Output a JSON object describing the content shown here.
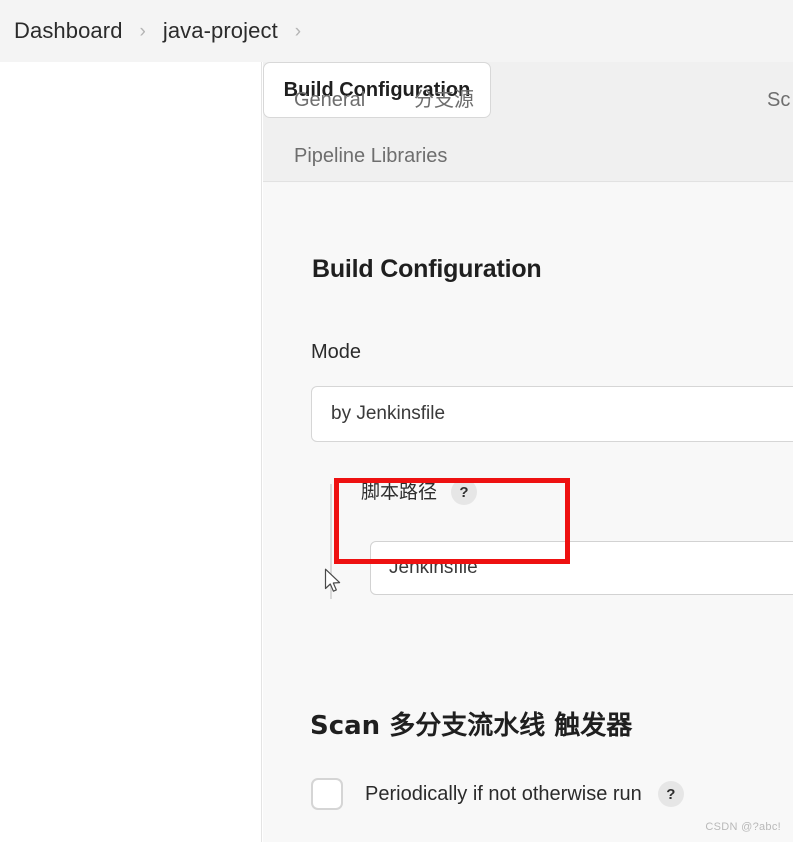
{
  "breadcrumb": {
    "items": [
      {
        "label": "Dashboard"
      },
      {
        "label": "java-project"
      }
    ],
    "separator": "›"
  },
  "tabs": [
    {
      "id": "general",
      "label": "General",
      "active": false
    },
    {
      "id": "branch-sources",
      "label": "分支源",
      "active": false
    },
    {
      "id": "build-configuration",
      "label": "Build Configuration",
      "active": true
    },
    {
      "id": "scan",
      "label": "Sc",
      "active": false,
      "truncated": true
    },
    {
      "id": "pipeline-libraries",
      "label": "Pipeline Libraries",
      "active": false
    }
  ],
  "main": {
    "section_title": "Build Configuration",
    "mode": {
      "label": "Mode",
      "selected_value": "by Jenkinsfile"
    },
    "script_path": {
      "label": "脚本路径",
      "help_icon": "question-mark-icon",
      "help_glyph": "?",
      "value": "Jenkinsfile"
    },
    "scan_triggers": {
      "title": "Scan 多分支流水线 触发器",
      "checkbox": {
        "label": "Periodically if not otherwise run",
        "checked": false,
        "help_icon": "question-mark-icon",
        "help_glyph": "?"
      }
    }
  },
  "annotation": {
    "type": "highlight-rectangle",
    "color": "#ee1111"
  },
  "cursor": {
    "type": "arrow-pointer"
  },
  "watermark": {
    "text": "CSDN @?abc!"
  },
  "colors": {
    "accent_red": "#ee1111",
    "chrome_gray": "#f0f0f0",
    "content_gray": "#f8f8f8",
    "panel_white": "#ffffff",
    "text_primary": "#1f1f1f",
    "text_secondary": "#6e6e6e"
  }
}
